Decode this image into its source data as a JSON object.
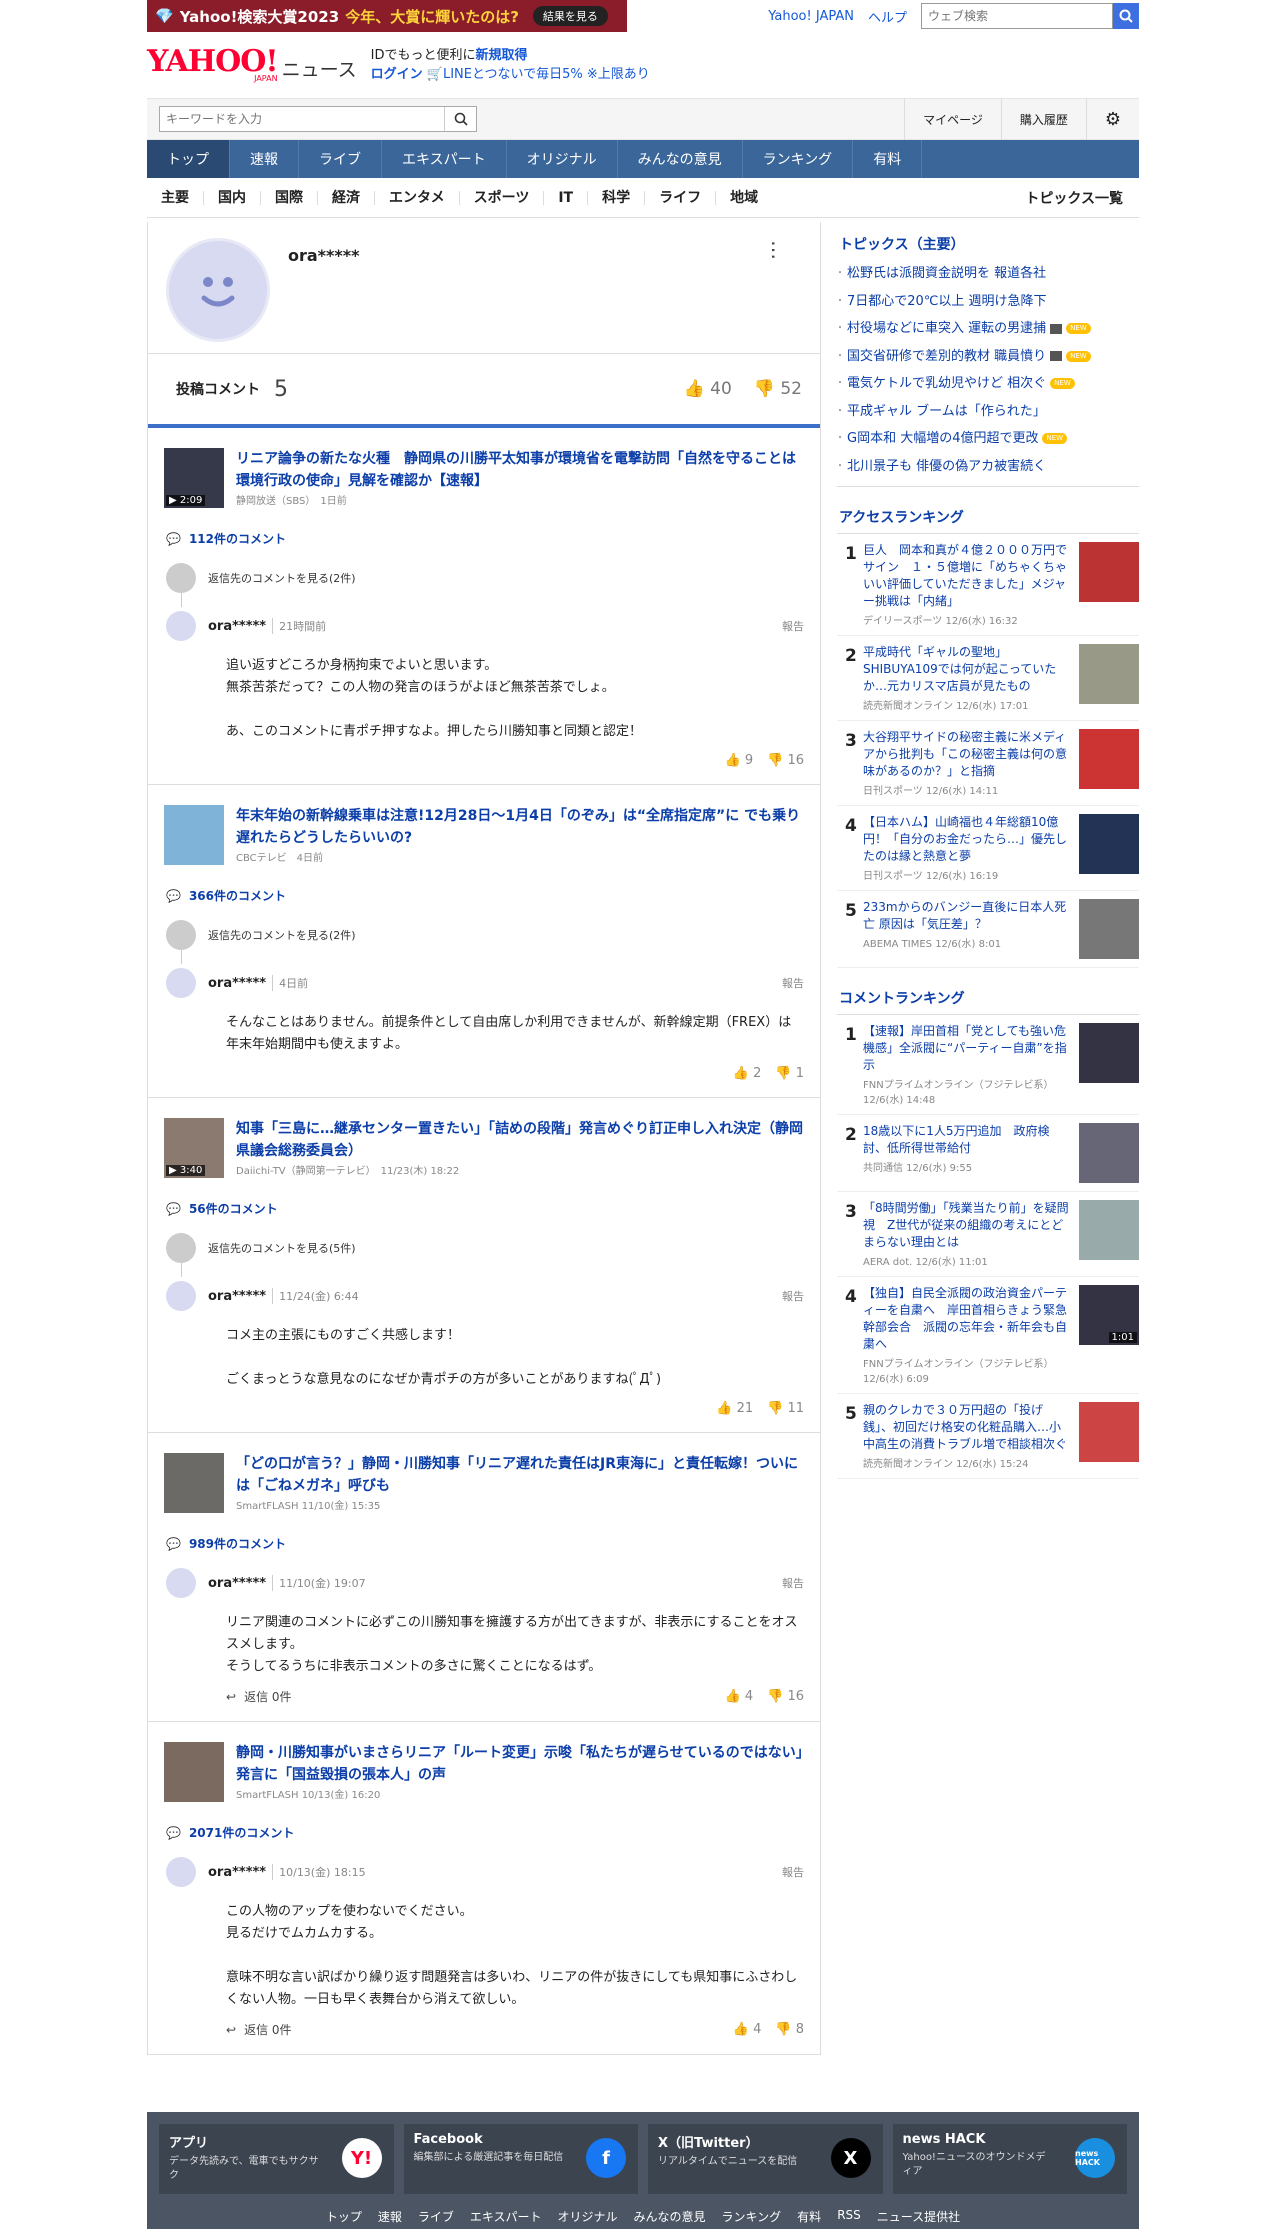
{
  "promo": {
    "text": "Yahoo!検索大賞2023",
    "highlight": "今年、大賞に輝いたのは?",
    "button": "結果を見る"
  },
  "toplinks": {
    "yahoo_japan": "Yahoo! JAPAN",
    "help": "ヘルプ",
    "search_placeholder": "ウェブ検索"
  },
  "header": {
    "logo": "YAHOO!",
    "logo_sub": "JAPAN",
    "section": "ニュース",
    "id_text": "IDでもっと便利に",
    "id_link": "新規取得",
    "login": "ログイン",
    "line": "LINEとつないで毎日5% ※上限あり"
  },
  "search": {
    "placeholder": "キーワードを入力",
    "mypage": "マイページ",
    "history": "購入履歴"
  },
  "gnav": [
    "トップ",
    "速報",
    "ライブ",
    "エキスパート",
    "オリジナル",
    "みんなの意見",
    "ランキング",
    "有料"
  ],
  "subnav": {
    "items": [
      "主要",
      "国内",
      "国際",
      "経済",
      "エンタメ",
      "スポーツ",
      "IT",
      "科学",
      "ライフ",
      "地域"
    ],
    "all": "トピックス一覧"
  },
  "profile": {
    "name": "ora*****",
    "stats_label": "投稿コメント",
    "count": "5",
    "likes": "40",
    "dislikes": "52"
  },
  "cards": [
    {
      "title": "リニア論争の新たな火種　静岡県の川勝平太知事が環境省を電撃訪問「自然を守ることは環境行政の使命」見解を確認か【速報】",
      "meta": "静岡放送（SBS）　1日前",
      "dur": "2:09",
      "comments": "112件のコメント",
      "replies": "返信先のコメントを見る(2件)",
      "user": "ora*****",
      "time": "21時間前",
      "report": "報告",
      "body": "追い返すどころか身柄拘束でよいと思います。\n無茶苦茶だって？この人物の発言のほうがよほど無茶苦茶でしょ。\n\nあ、このコメントに青ポチ押すなよ。押したら川勝知事と同類と認定！",
      "up": "9",
      "down": "16"
    },
    {
      "title": "年末年始の新幹線乗車は注意!12月28日～1月4日「のぞみ」は“全席指定席”に でも乗り遅れたらどうしたらいいの?",
      "meta": "CBCテレビ　4日前",
      "dur": "",
      "comments": "366件のコメント",
      "replies": "返信先のコメントを見る(2件)",
      "user": "ora*****",
      "time": "4日前",
      "report": "報告",
      "body": "そんなことはありません。前提条件として自由席しか利用できませんが、新幹線定期（FREX）は年末年始期間中も使えますよ。",
      "up": "2",
      "down": "1"
    },
    {
      "title": "知事「三島に…継承センター置きたい」「詰めの段階」発言めぐり訂正申し入れ決定（静岡県議会総務委員会）",
      "meta": "Daiichi-TV（静岡第一テレビ）　11/23(木) 18:22",
      "dur": "3:40",
      "comments": "56件のコメント",
      "replies": "返信先のコメントを見る(5件)",
      "user": "ora*****",
      "time": "11/24(金) 6:44",
      "report": "報告",
      "body": "コメ主の主張にものすごく共感します！\n\nごくまっとうな意見なのになぜか青ポチの方が多いことがありますね(ﾟДﾟ)",
      "up": "21",
      "down": "11"
    },
    {
      "title": "「どの口が言う？」静岡・川勝知事「リニア遅れた責任はJR東海に」と責任転嫁！ついには「ごねメガネ」呼びも",
      "meta": "SmartFLASH 11/10(金) 15:35",
      "dur": "",
      "comments": "989件のコメント",
      "replies": "",
      "user": "ora*****",
      "time": "11/10(金) 19:07",
      "report": "報告",
      "body": "リニア関連のコメントに必ずこの川勝知事を擁護する方が出てきますが、非表示にすることをオススメします。\nそうしてるうちに非表示コメントの多さに驚くことになるはず。",
      "reply": "返信 0件",
      "up": "4",
      "down": "16"
    },
    {
      "title": "静岡・川勝知事がいまさらリニア「ルート変更」示唆「私たちが遅らせているのではない」発言に「国益毀損の張本人」の声",
      "meta": "SmartFLASH 10/13(金) 16:20",
      "dur": "",
      "comments": "2071件のコメント",
      "replies": "",
      "user": "ora*****",
      "time": "10/13(金) 18:15",
      "report": "報告",
      "body": "この人物のアップを使わないでください。\n見るだけでムカムカする。\n\n意味不明な言い訳ばかり繰り返す問題発言は多いわ、リニアの件が抜きにしても県知事にふさわしくない人物。一日も早く表舞台から消えて欲しい。",
      "reply": "返信 0件",
      "up": "4",
      "down": "8"
    }
  ],
  "topics": {
    "heading": "トピックス（主要）",
    "items": [
      {
        "t": "松野氏は派閥資金説明を 報道各社",
        "v": false,
        "n": false
      },
      {
        "t": "7日都心で20℃以上 週明け急降下",
        "v": false,
        "n": false
      },
      {
        "t": "村役場などに車突入 運転の男逮捕",
        "v": true,
        "n": true
      },
      {
        "t": "国交省研修で差別的教材 職員憤り",
        "v": true,
        "n": true
      },
      {
        "t": "電気ケトルで乳幼児やけど 相次ぐ",
        "v": false,
        "n": true
      },
      {
        "t": "平成ギャル ブームは「作られた」",
        "v": false,
        "n": false
      },
      {
        "t": "G岡本和 大幅増の4億円超で更改",
        "v": false,
        "n": true
      },
      {
        "t": "北川景子も 俳優の偽アカ被害続く",
        "v": false,
        "n": false
      }
    ]
  },
  "new_label": "NEW",
  "access": {
    "heading": "アクセスランキング",
    "items": [
      {
        "t": "巨人　岡本和真が４億２０００万円でサイン　１・５億増に「めちゃくちゃいい評価していただきました」メジャー挑戦は「内緒」",
        "m": "デイリースポーツ 12/6(水) 16:32",
        "c": "#b33"
      },
      {
        "t": "平成時代「ギャルの聖地」SHIBUYA109では何が起こっていたか…元カリスマ店員が見たもの",
        "m": "読売新聞オンライン 12/6(水) 17:01",
        "c": "#998"
      },
      {
        "t": "大谷翔平サイドの秘密主義に米メディアから批判も「この秘密主義は何の意味があるのか？」と指摘",
        "m": "日刊スポーツ 12/6(水) 14:11",
        "c": "#c33"
      },
      {
        "t": "【日本ハム】山崎福也４年総額10億円！「自分のお金だったら…」優先したのは縁と熱意と夢",
        "m": "日刊スポーツ 12/6(水) 16:19",
        "c": "#235"
      },
      {
        "t": "233mからのバンジー直後に日本人死亡 原因は「気圧差」？",
        "m": "ABEMA TIMES 12/6(水) 8:01",
        "c": "#777"
      }
    ]
  },
  "comment_rank": {
    "heading": "コメントランキング",
    "items": [
      {
        "t": "【速報】岸田首相「党としても強い危機感」全派閥に“パーティー自粛”を指示",
        "m": "FNNプライムオンライン（フジテレビ系） 12/6(水) 14:48",
        "c": "#334",
        "dur": ""
      },
      {
        "t": "18歳以下に1人5万円追加　政府検討、低所得世帯給付",
        "m": "共同通信 12/6(水) 9:55",
        "c": "#667"
      },
      {
        "t": "「8時間労働」「残業当たり前」を疑問視　Z世代が従来の組織の考えにとどまらない理由とは",
        "m": "AERA dot. 12/6(水) 11:01",
        "c": "#9aa"
      },
      {
        "t": "【独自】自民全派閥の政治資金パーティーを自粛へ　岸田首相らきょう緊急幹部会合　派閥の忘年会・新年会も自粛へ",
        "m": "FNNプライムオンライン（フジテレビ系） 12/6(水) 6:09",
        "c": "#334",
        "dur": "1:01"
      },
      {
        "t": "親のクレカで３０万円超の「投げ銭」、初回だけ格安の化粧品購入…小中高生の消費トラブル増で相談相次ぐ",
        "m": "読売新聞オンライン 12/6(水) 15:24",
        "c": "#c44"
      }
    ]
  },
  "footer": {
    "cards": [
      {
        "t": "アプリ",
        "d": "データ先読みで、電車でもサクサク",
        "icon": "Y!",
        "bg": "#fff",
        "fg": "#f03"
      },
      {
        "t": "Facebook",
        "d": "編集部による厳選記事を毎日配信",
        "icon": "f",
        "bg": "#1877f2",
        "fg": "#fff"
      },
      {
        "t": "X（旧Twitter）",
        "d": "リアルタイムでニュースを配信",
        "icon": "X",
        "bg": "#000",
        "fg": "#fff"
      },
      {
        "t": "news HACK",
        "d": "Yahoo!ニュースのオウンドメディア",
        "icon": "news HACK",
        "bg": "#1a8fe0",
        "fg": "#fff"
      }
    ],
    "links": [
      "トップ",
      "速報",
      "ライブ",
      "エキスパート",
      "オリジナル",
      "みんなの意見",
      "ランキング",
      "有料",
      "RSS",
      "ニュース提供社"
    ]
  }
}
